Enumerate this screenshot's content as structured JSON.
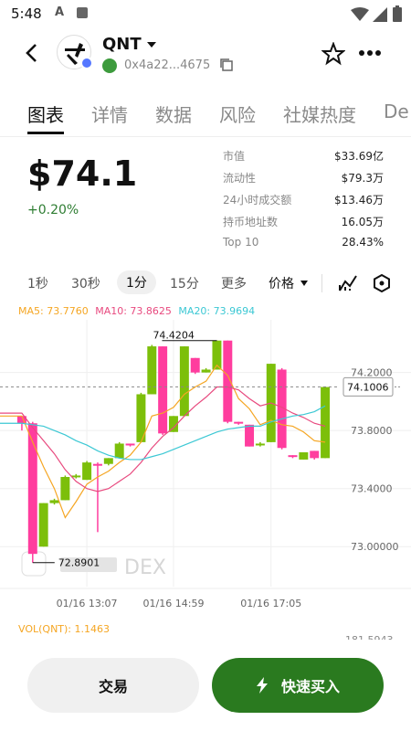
{
  "status_bar": {
    "time": "5:48"
  },
  "header": {
    "token_name": "QNT",
    "address": "0x4a22...4675"
  },
  "tabs": [
    {
      "label": "图表",
      "active": true
    },
    {
      "label": "详情"
    },
    {
      "label": "数据"
    },
    {
      "label": "风险"
    },
    {
      "label": "社媒热度"
    },
    {
      "label": "De"
    }
  ],
  "price_panel": {
    "price": "$74.1",
    "change": "+0.20%",
    "change_color": "#2e7d32"
  },
  "stats": [
    {
      "label": "市值",
      "value": "$33.69亿"
    },
    {
      "label": "流动性",
      "value": "$79.3万"
    },
    {
      "label": "24小时成交额",
      "value": "$13.46万"
    },
    {
      "label": "持币地址数",
      "value": "16.05万"
    },
    {
      "label": "Top 10",
      "value": "28.43%"
    }
  ],
  "timeframes": [
    "1秒",
    "30秒",
    "1分",
    "15分",
    "更多"
  ],
  "active_timeframe": "1分",
  "price_selector": "价格",
  "ma": {
    "ma5": "MA5: 73.7760",
    "ma10": "MA10: 73.8625",
    "ma20": "MA20: 73.9694"
  },
  "chart_data": {
    "type": "candlestick",
    "y_ticks": [
      "74.2000",
      "73.8000",
      "73.4000",
      "73.00000"
    ],
    "ylim": [
      72.8,
      74.5
    ],
    "x_ticks": [
      "01/16 13:07",
      "01/16 14:59",
      "01/16 17:05"
    ],
    "current_price_label": "74.1006",
    "high_label": "74.4204",
    "low_label": "72.8901",
    "watermark": "DEX",
    "colors": {
      "up": "#7cbf0a",
      "down": "#ff3d9e"
    },
    "candles": [
      {
        "o": 73.9,
        "c": 73.85,
        "h": 73.9,
        "l": 73.8
      },
      {
        "o": 73.85,
        "c": 72.95,
        "h": 73.86,
        "l": 72.89
      },
      {
        "o": 73.0,
        "c": 73.3,
        "h": 73.3,
        "l": 73.0
      },
      {
        "o": 73.3,
        "c": 73.32,
        "h": 73.33,
        "l": 73.29
      },
      {
        "o": 73.32,
        "c": 73.48,
        "h": 73.49,
        "l": 73.32
      },
      {
        "o": 73.48,
        "c": 73.49,
        "h": 73.5,
        "l": 73.47
      },
      {
        "o": 73.46,
        "c": 73.58,
        "h": 73.59,
        "l": 73.46
      },
      {
        "o": 73.57,
        "c": 73.56,
        "h": 73.58,
        "l": 73.1
      },
      {
        "o": 73.57,
        "c": 73.61,
        "h": 73.61,
        "l": 73.56
      },
      {
        "o": 73.61,
        "c": 73.71,
        "h": 73.72,
        "l": 73.61
      },
      {
        "o": 73.71,
        "c": 73.7,
        "h": 73.71,
        "l": 73.69
      },
      {
        "o": 73.72,
        "c": 74.05,
        "h": 74.06,
        "l": 73.72
      },
      {
        "o": 74.05,
        "c": 74.38,
        "h": 74.39,
        "l": 74.05
      },
      {
        "o": 74.38,
        "c": 73.78,
        "h": 74.38,
        "l": 73.77
      },
      {
        "o": 73.79,
        "c": 73.9,
        "h": 73.9,
        "l": 73.79
      },
      {
        "o": 73.9,
        "c": 74.38,
        "h": 74.38,
        "l": 73.9
      },
      {
        "o": 74.3,
        "c": 74.2,
        "h": 74.3,
        "l": 74.19
      },
      {
        "o": 74.2,
        "c": 74.22,
        "h": 74.23,
        "l": 74.2
      },
      {
        "o": 74.22,
        "c": 74.42,
        "h": 74.42,
        "l": 74.22
      },
      {
        "o": 74.42,
        "c": 73.86,
        "h": 74.42,
        "l": 73.85
      },
      {
        "o": 73.86,
        "c": 73.85,
        "h": 73.86,
        "l": 73.84
      },
      {
        "o": 73.84,
        "c": 73.69,
        "h": 73.84,
        "l": 73.69
      },
      {
        "o": 73.7,
        "c": 73.71,
        "h": 73.72,
        "l": 73.69
      },
      {
        "o": 73.72,
        "c": 74.26,
        "h": 74.26,
        "l": 73.72
      },
      {
        "o": 74.22,
        "c": 73.68,
        "h": 74.23,
        "l": 73.67
      },
      {
        "o": 73.63,
        "c": 73.62,
        "h": 73.63,
        "l": 73.61
      },
      {
        "o": 73.6,
        "c": 73.65,
        "h": 73.65,
        "l": 73.6
      },
      {
        "o": 73.66,
        "c": 73.61,
        "h": 73.66,
        "l": 73.6
      },
      {
        "o": 73.61,
        "c": 74.1,
        "h": 74.1,
        "l": 73.61
      }
    ],
    "series": [
      {
        "name": "MA5",
        "color": "#f5a623",
        "values": [
          73.9,
          73.72,
          73.55,
          73.4,
          73.2,
          73.31,
          73.43,
          73.48,
          73.52,
          73.58,
          73.63,
          73.72,
          73.9,
          73.92,
          73.96,
          74.05,
          74.1,
          74.14,
          74.25,
          74.18,
          74.02,
          73.95,
          73.84,
          73.87,
          73.84,
          73.83,
          73.79,
          73.73,
          73.72
        ]
      },
      {
        "name": "MA10",
        "color": "#e84a7f",
        "values": [
          73.92,
          73.82,
          73.73,
          73.64,
          73.53,
          73.45,
          73.4,
          73.38,
          73.4,
          73.45,
          73.5,
          73.58,
          73.68,
          73.76,
          73.82,
          73.9,
          73.97,
          74.03,
          74.1,
          74.1,
          74.08,
          74.02,
          73.97,
          73.99,
          73.96,
          73.92,
          73.89,
          73.85,
          73.83
        ]
      },
      {
        "name": "MA20",
        "color": "#3cc8d4",
        "values": [
          73.85,
          73.84,
          73.83,
          73.8,
          73.77,
          73.73,
          73.7,
          73.66,
          73.63,
          73.61,
          73.6,
          73.6,
          73.62,
          73.64,
          73.67,
          73.7,
          73.73,
          73.76,
          73.79,
          73.81,
          73.82,
          73.83,
          73.83,
          73.86,
          73.88,
          73.9,
          73.91,
          73.93,
          73.97
        ]
      }
    ]
  },
  "volume": {
    "label": "VOL(QNT): 1.1463",
    "right_tick": "181.5943"
  },
  "footer": {
    "trade_label": "交易",
    "buy_label": "快速买入"
  }
}
